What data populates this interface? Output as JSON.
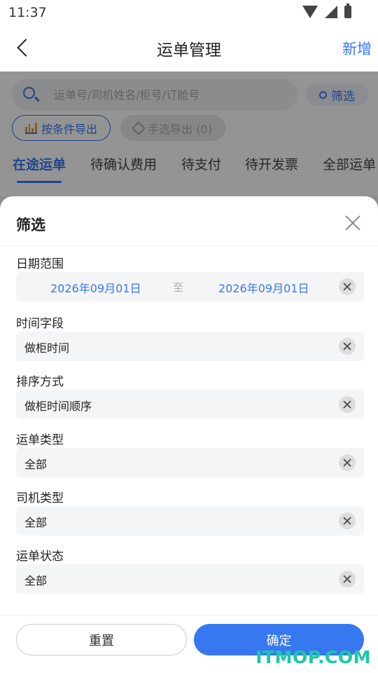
{
  "status_bar": {
    "time": "11:37"
  },
  "header": {
    "title": "运单管理",
    "add_label": "新增"
  },
  "search": {
    "placeholder": "运单号/司机姓名/柜号/订舱号",
    "filter_label": "筛选"
  },
  "actions": {
    "export_by_condition": "按条件导出",
    "export_manual": "手选导出 (0)"
  },
  "tabs": [
    {
      "label": "在途运单",
      "active": true
    },
    {
      "label": "待确认费用",
      "active": false
    },
    {
      "label": "待支付",
      "active": false
    },
    {
      "label": "待开发票",
      "active": false
    },
    {
      "label": "全部运单",
      "active": false
    }
  ],
  "filter_sheet": {
    "title": "筛选",
    "date_range": {
      "label": "日期范围",
      "start": "2026年09月01日",
      "separator": "至",
      "end": "2026年09月01日"
    },
    "fields": [
      {
        "label": "时间字段",
        "value": "做柜时间"
      },
      {
        "label": "排序方式",
        "value": "做柜时间顺序"
      },
      {
        "label": "运单类型",
        "value": "全部"
      },
      {
        "label": "司机类型",
        "value": "全部"
      },
      {
        "label": "运单状态",
        "value": "全部"
      }
    ],
    "reset_label": "重置",
    "confirm_label": "确定"
  },
  "watermark": "ITMOP.COM",
  "colors": {
    "accent": "#3778f0",
    "watermark": "#1cc7a8"
  }
}
